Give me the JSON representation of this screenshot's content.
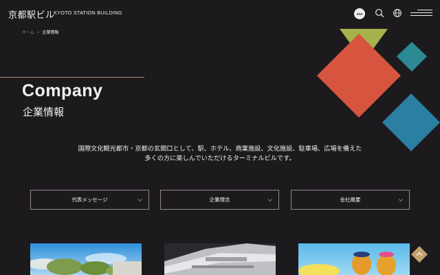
{
  "header": {
    "logo_jp": "京都駅ビル",
    "logo_en": "KYOTO STATION BUILDING",
    "sns_label": "SNS",
    "icons": [
      "search-icon",
      "globe-icon",
      "menu-icon"
    ]
  },
  "breadcrumb": {
    "home": "ホーム",
    "separator": "•",
    "current": "企業情報"
  },
  "page": {
    "title_en": "Company",
    "title_jp": "企業情報"
  },
  "intro": {
    "line1": "国際文化観光都市・京都の玄関口として、駅、ホテル、商業施設、文化施設、駐車場、広場を備えた",
    "line2": "多くの方に楽しんでいただけるターミナルビルです。"
  },
  "nav": [
    {
      "label": "代表メッセージ"
    },
    {
      "label": "企業理念"
    },
    {
      "label": "会社概要"
    }
  ],
  "colors": {
    "background": "#1d1a1e",
    "accent_line": "#b08a6a",
    "deco_olive": "#a7b24d",
    "deco_red": "#d7553e",
    "deco_teal": "#2b8a93",
    "deco_blue": "#2a7fa2",
    "page_top_button": "#c4a06e"
  }
}
